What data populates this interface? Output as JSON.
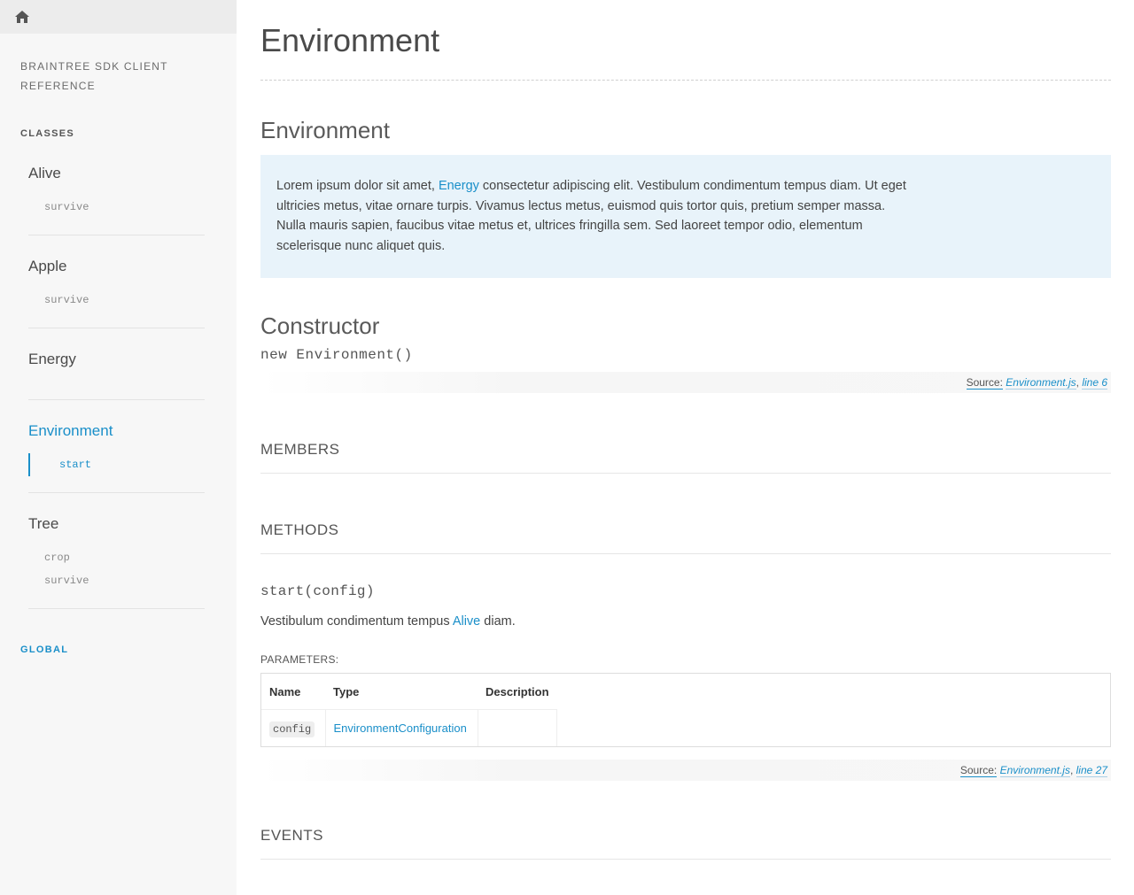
{
  "sidebar": {
    "home_icon": "home-icon",
    "sdk_title": "BRAINTREE SDK CLIENT REFERENCE",
    "classes_heading": "CLASSES",
    "classes": [
      {
        "name": "Alive",
        "members": [
          "survive"
        ]
      },
      {
        "name": "Apple",
        "members": [
          "survive"
        ]
      },
      {
        "name": "Energy",
        "members": []
      },
      {
        "name": "Environment",
        "members": [
          "start"
        ],
        "active": true
      },
      {
        "name": "Tree",
        "members": [
          "crop",
          "survive"
        ]
      }
    ],
    "global_label": "GLOBAL"
  },
  "main": {
    "page_title": "Environment",
    "class_title": "Environment",
    "description": {
      "before": "Lorem ipsum dolor sit amet, ",
      "link": "Energy",
      "after": " consectetur adipiscing elit. Vestibulum condimentum tempus diam. Ut eget ultricies metus, vitae ornare turpis. Vivamus lectus metus, euismod quis tortor quis, pretium semper massa. Nulla mauris sapien, faucibus vitae metus et, ultrices fringilla sem. Sed laoreet tempor odio, elementum scelerisque nunc aliquet quis."
    },
    "constructor_heading": "Constructor",
    "constructor_signature": "new Environment()",
    "constructor_source": {
      "label": "Source:",
      "file": "Environment.js",
      "sep": ", ",
      "line": "line 6"
    },
    "members_heading": "MEMBERS",
    "methods_heading": "METHODS",
    "method": {
      "signature": "start(config)",
      "desc_before": "Vestibulum condimentum tempus ",
      "desc_link": "Alive",
      "desc_after": " diam.",
      "params_label": "PARAMETERS:",
      "params_headers": [
        "Name",
        "Type",
        "Description"
      ],
      "params_rows": [
        {
          "name": "config",
          "type": "EnvironmentConfiguration",
          "description": ""
        }
      ],
      "source": {
        "label": "Source:",
        "file": "Environment.js",
        "sep": ", ",
        "line": "line 27"
      }
    },
    "events_heading": "EVENTS"
  },
  "colors": {
    "accent": "#1a8fc9",
    "sidebar_bg": "#f7f7f7",
    "description_bg": "#e8f3fa"
  }
}
